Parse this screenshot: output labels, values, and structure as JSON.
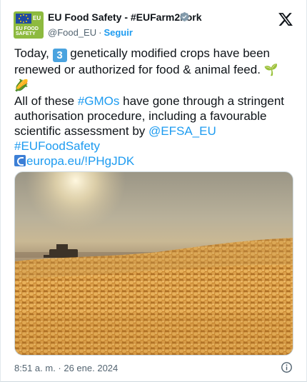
{
  "header": {
    "account_name": "EU Food Safety - #EUFarm2Fork",
    "handle": "@Food_EU",
    "separator": "·",
    "follow_label": "Seguir",
    "avatar_text": "EU FOOD SAFETY",
    "avatar_eu": "EU"
  },
  "tweet": {
    "line1_before": "Today, ",
    "number_emoji": "3",
    "line1_after": " genetically modified crops have been renewed or authorized for food & animal feed. ",
    "emoji_seedling": "🌱",
    "emoji_corn": "🌽",
    "line2_before": "All of these ",
    "hashtag_gmos": "#GMOs",
    "line2_after": " have gone through a stringent authorisation procedure, including a favourable scientific assessment by ",
    "mention_efsa": "@EFSA_EU",
    "hashtag_eufoodsafety": "#EUFoodSafety",
    "url": "europa.eu/!PHgJDK"
  },
  "footer": {
    "timestamp": "8:51 a. m. · 26 ene. 2024"
  },
  "colors": {
    "link": "#1d9bf0",
    "verified": "#829aab",
    "avatar_green": "#8dba3f"
  },
  "icons": [
    "verified-badge-icon",
    "x-logo-icon",
    "link-icon",
    "info-icon"
  ]
}
